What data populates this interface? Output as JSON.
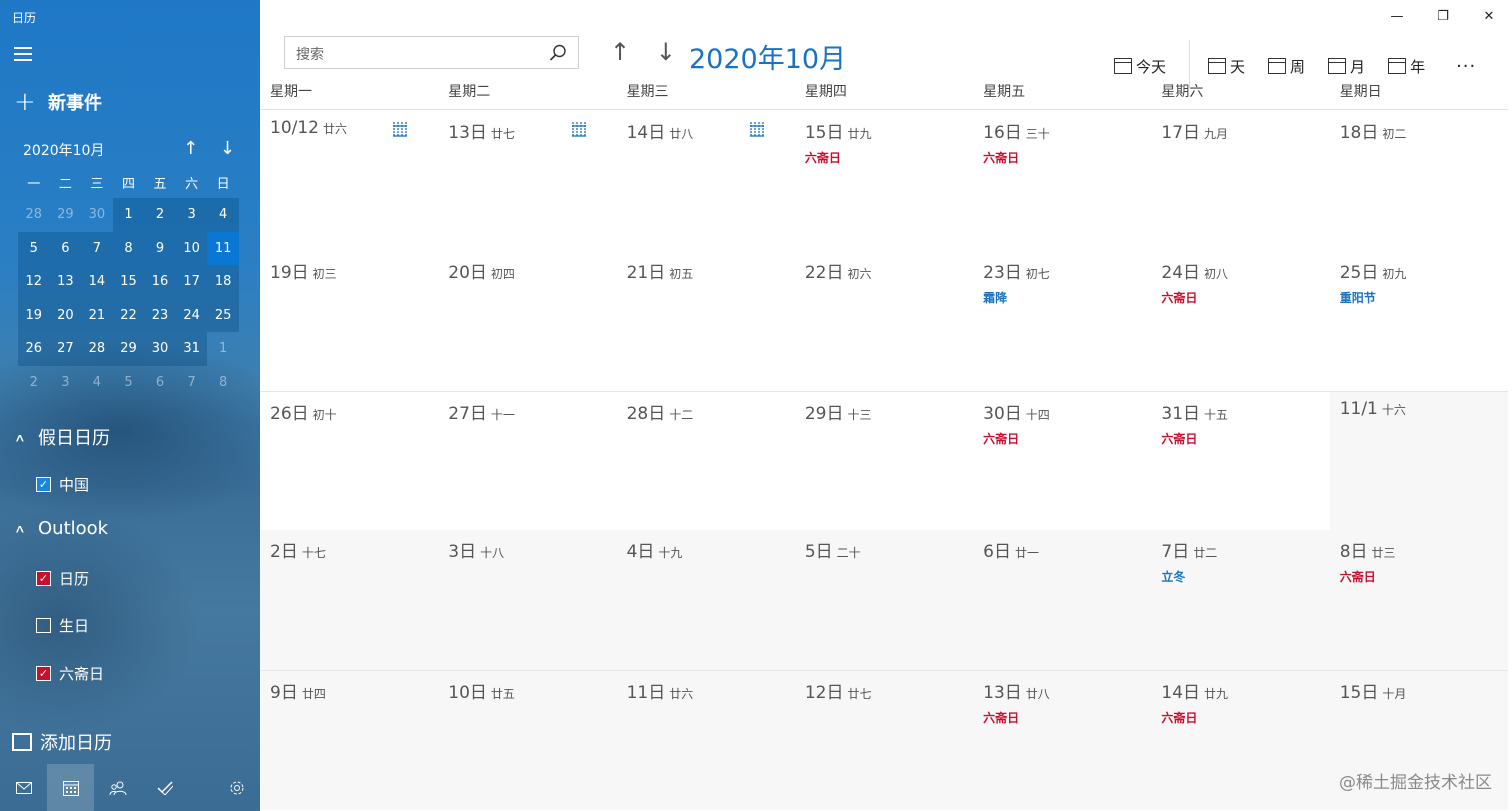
{
  "app": {
    "title": "日历"
  },
  "window_controls": {
    "minimize": "—",
    "restore": "❐",
    "close": "✕"
  },
  "sidebar": {
    "new_event": "新事件",
    "mini_calendar": {
      "title": "2020年10月",
      "up": "↑",
      "down": "↓",
      "weekdays": [
        "一",
        "二",
        "三",
        "四",
        "五",
        "六",
        "日"
      ],
      "rows": [
        [
          {
            "d": "28",
            "k": "other"
          },
          {
            "d": "29",
            "k": "other"
          },
          {
            "d": "30",
            "k": "other"
          },
          {
            "d": "1",
            "k": "inmonth"
          },
          {
            "d": "2",
            "k": "inmonth"
          },
          {
            "d": "3",
            "k": "inmonth"
          },
          {
            "d": "4",
            "k": "inmonth"
          }
        ],
        [
          {
            "d": "5",
            "k": "inmonth"
          },
          {
            "d": "6",
            "k": "inmonth"
          },
          {
            "d": "7",
            "k": "inmonth"
          },
          {
            "d": "8",
            "k": "inmonth"
          },
          {
            "d": "9",
            "k": "inmonth"
          },
          {
            "d": "10",
            "k": "inmonth"
          },
          {
            "d": "11",
            "k": "today"
          }
        ],
        [
          {
            "d": "12",
            "k": "inmonth"
          },
          {
            "d": "13",
            "k": "inmonth"
          },
          {
            "d": "14",
            "k": "inmonth"
          },
          {
            "d": "15",
            "k": "inmonth"
          },
          {
            "d": "16",
            "k": "inmonth"
          },
          {
            "d": "17",
            "k": "inmonth"
          },
          {
            "d": "18",
            "k": "inmonth"
          }
        ],
        [
          {
            "d": "19",
            "k": "inmonth"
          },
          {
            "d": "20",
            "k": "inmonth"
          },
          {
            "d": "21",
            "k": "inmonth"
          },
          {
            "d": "22",
            "k": "inmonth"
          },
          {
            "d": "23",
            "k": "inmonth"
          },
          {
            "d": "24",
            "k": "inmonth"
          },
          {
            "d": "25",
            "k": "inmonth"
          }
        ],
        [
          {
            "d": "26",
            "k": "inmonth"
          },
          {
            "d": "27",
            "k": "inmonth"
          },
          {
            "d": "28",
            "k": "inmonth"
          },
          {
            "d": "29",
            "k": "inmonth"
          },
          {
            "d": "30",
            "k": "inmonth"
          },
          {
            "d": "31",
            "k": "inmonth"
          },
          {
            "d": "1",
            "k": "other"
          }
        ],
        [
          {
            "d": "2",
            "k": "other"
          },
          {
            "d": "3",
            "k": "other"
          },
          {
            "d": "4",
            "k": "other"
          },
          {
            "d": "5",
            "k": "other"
          },
          {
            "d": "6",
            "k": "other"
          },
          {
            "d": "7",
            "k": "other"
          },
          {
            "d": "8",
            "k": "other"
          }
        ]
      ]
    },
    "holiday_section": "假日日历",
    "holiday_items": [
      {
        "label": "中国",
        "checked": true,
        "color": "blue"
      }
    ],
    "outlook_section": "Outlook",
    "outlook_items": [
      {
        "label": "日历",
        "checked": true,
        "color": "red"
      },
      {
        "label": "生日",
        "checked": false,
        "color": "none"
      },
      {
        "label": "六斋日",
        "checked": true,
        "color": "red"
      }
    ],
    "add_calendar": "添加日历",
    "bottom_icons": [
      "mail-icon",
      "calendar-icon",
      "people-icon",
      "todo-icon",
      "settings-icon"
    ]
  },
  "toolbar": {
    "search_placeholder": "搜索",
    "nav_up": "↑",
    "nav_down": "↓",
    "month_title": "2020年10月",
    "views": [
      "今天",
      "天",
      "周",
      "月",
      "年"
    ],
    "more": "···"
  },
  "month_view": {
    "weekdays": [
      "星期一",
      "星期二",
      "星期三",
      "星期四",
      "星期五",
      "星期六",
      "星期日"
    ],
    "weeks": [
      [
        {
          "num": "10/12",
          "lunar": "廿六",
          "icon": true
        },
        {
          "num": "13日",
          "lunar": "廿七",
          "icon": true
        },
        {
          "num": "14日",
          "lunar": "廿八",
          "icon": true
        },
        {
          "num": "15日",
          "lunar": "廿九",
          "event": "六斋日",
          "ec": "red"
        },
        {
          "num": "16日",
          "lunar": "三十",
          "event": "六斋日",
          "ec": "red"
        },
        {
          "num": "17日",
          "lunar": "九月"
        },
        {
          "num": "18日",
          "lunar": "初二"
        }
      ],
      [
        {
          "num": "19日",
          "lunar": "初三"
        },
        {
          "num": "20日",
          "lunar": "初四"
        },
        {
          "num": "21日",
          "lunar": "初五"
        },
        {
          "num": "22日",
          "lunar": "初六"
        },
        {
          "num": "23日",
          "lunar": "初七",
          "event": "霜降",
          "ec": "blue"
        },
        {
          "num": "24日",
          "lunar": "初八",
          "event": "六斋日",
          "ec": "red"
        },
        {
          "num": "25日",
          "lunar": "初九",
          "event": "重阳节",
          "ec": "blue"
        }
      ],
      [
        {
          "num": "26日",
          "lunar": "初十",
          "top": true
        },
        {
          "num": "27日",
          "lunar": "十一",
          "top": true
        },
        {
          "num": "28日",
          "lunar": "十二",
          "top": true
        },
        {
          "num": "29日",
          "lunar": "十三",
          "top": true
        },
        {
          "num": "30日",
          "lunar": "十四",
          "event": "六斋日",
          "ec": "red",
          "top": true
        },
        {
          "num": "31日",
          "lunar": "十五",
          "event": "六斋日",
          "ec": "red",
          "top": true
        },
        {
          "num": "11/1",
          "lunar": "十六",
          "dim": true,
          "top": true
        }
      ],
      [
        {
          "num": "2日",
          "lunar": "十七",
          "dim": true
        },
        {
          "num": "3日",
          "lunar": "十八",
          "dim": true
        },
        {
          "num": "4日",
          "lunar": "十九",
          "dim": true
        },
        {
          "num": "5日",
          "lunar": "二十",
          "dim": true
        },
        {
          "num": "6日",
          "lunar": "廿一",
          "dim": true
        },
        {
          "num": "7日",
          "lunar": "廿二",
          "event": "立冬",
          "ec": "blue",
          "dim": true
        },
        {
          "num": "8日",
          "lunar": "廿三",
          "event": "六斋日",
          "ec": "red",
          "dim": true
        }
      ],
      [
        {
          "num": "9日",
          "lunar": "廿四",
          "dim": true,
          "top": true
        },
        {
          "num": "10日",
          "lunar": "廿五",
          "dim": true,
          "top": true
        },
        {
          "num": "11日",
          "lunar": "廿六",
          "dim": true,
          "top": true
        },
        {
          "num": "12日",
          "lunar": "廿七",
          "dim": true,
          "top": true
        },
        {
          "num": "13日",
          "lunar": "廿八",
          "event": "六斋日",
          "ec": "red",
          "dim": true,
          "top": true
        },
        {
          "num": "14日",
          "lunar": "廿九",
          "event": "六斋日",
          "ec": "red",
          "dim": true,
          "top": true
        },
        {
          "num": "15日",
          "lunar": "十月",
          "dim": true,
          "top": true
        }
      ]
    ]
  },
  "watermark": "@稀土掘金技术社区"
}
